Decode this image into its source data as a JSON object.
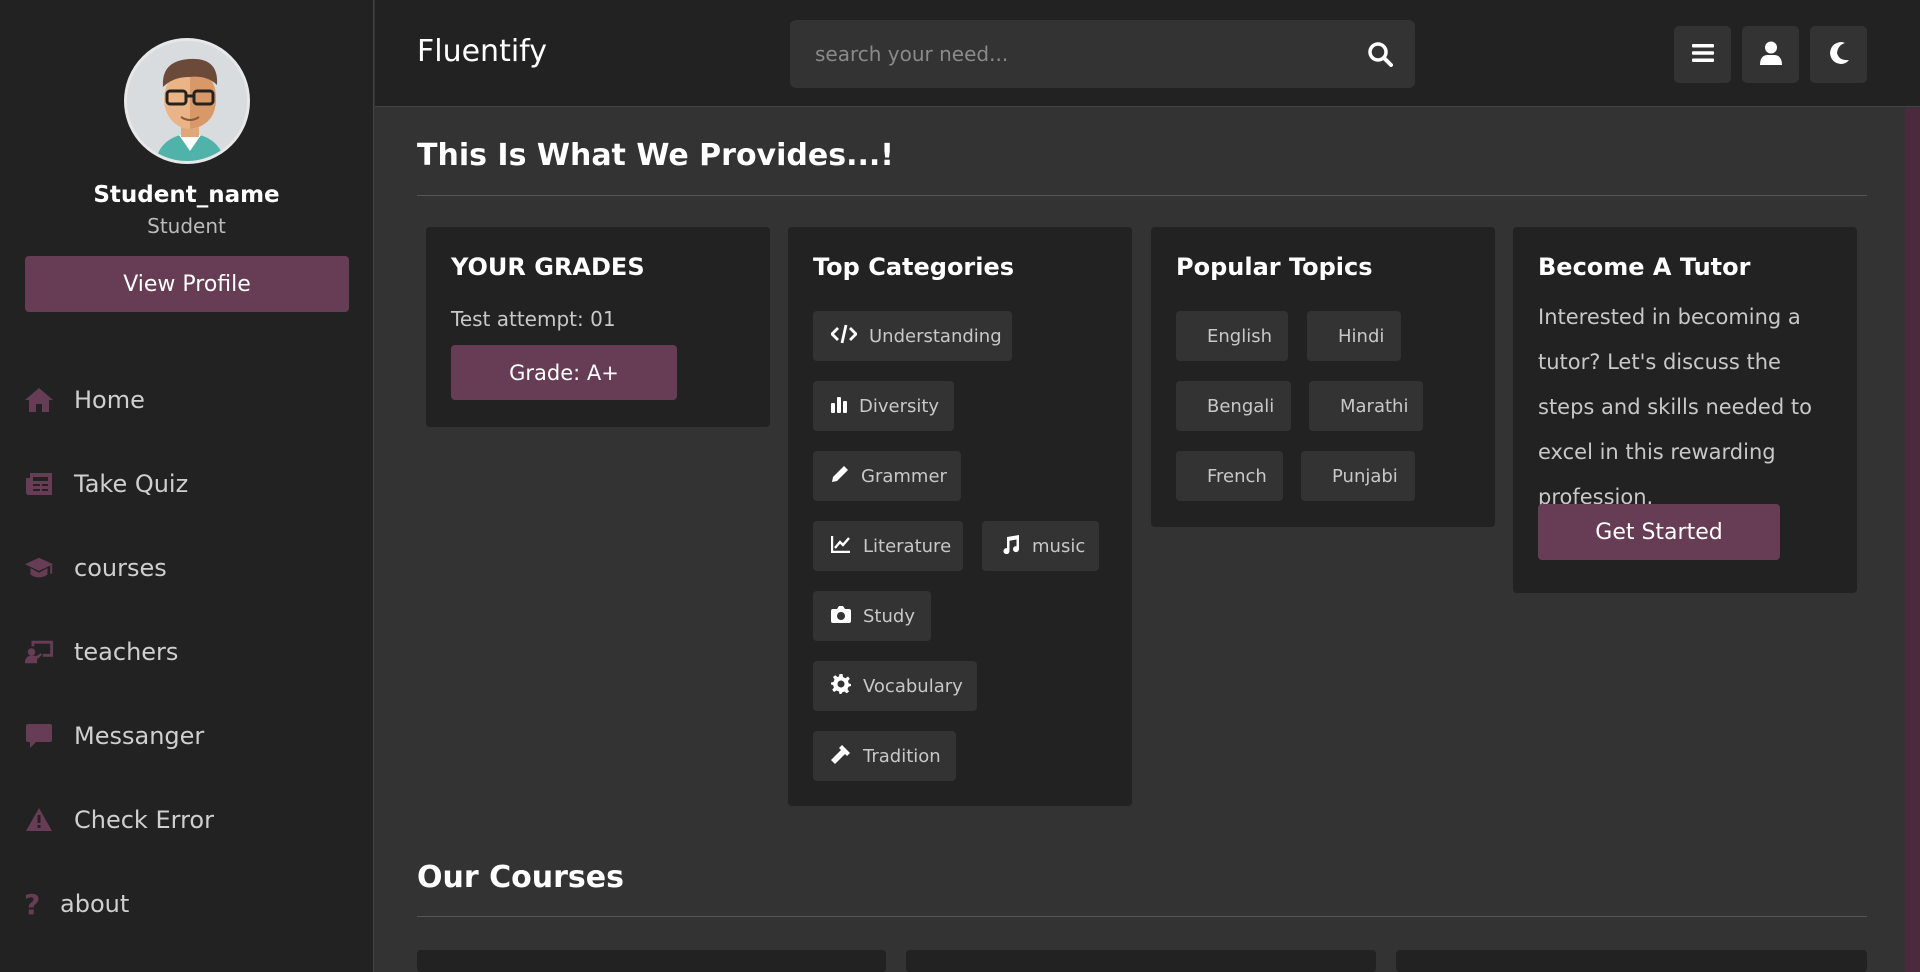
{
  "sidebar": {
    "student_name": "Student_name",
    "student_role": "Student",
    "view_profile_label": "View Profile",
    "items": [
      {
        "label": "Home",
        "icon": "home-icon"
      },
      {
        "label": "Take Quiz",
        "icon": "newspaper-icon"
      },
      {
        "label": "courses",
        "icon": "graduation-cap-icon"
      },
      {
        "label": "teachers",
        "icon": "chalkboard-teacher-icon"
      },
      {
        "label": "Messanger",
        "icon": "comment-icon"
      },
      {
        "label": "Check Error",
        "icon": "warning-icon"
      },
      {
        "label": "about",
        "icon": "question-icon"
      }
    ]
  },
  "header": {
    "brand": "Fluentify",
    "search_placeholder": "search your need...",
    "buttons": [
      "menu-icon",
      "user-icon",
      "moon-icon"
    ]
  },
  "main": {
    "section1_title": "This Is What We Provides...!",
    "grades": {
      "title": "YOUR GRADES",
      "attempt": "Test attempt: 01",
      "grade_label": "Grade: A+"
    },
    "categories": {
      "title": "Top Categories",
      "tags": [
        {
          "label": "Understanding",
          "icon": "code-icon"
        },
        {
          "label": "Diversity",
          "icon": "chart-bar-icon"
        },
        {
          "label": "Grammer",
          "icon": "pencil-icon"
        },
        {
          "label": "Literature",
          "icon": "chart-line-icon"
        },
        {
          "label": "music",
          "icon": "music-icon"
        },
        {
          "label": "Study",
          "icon": "camera-icon"
        },
        {
          "label": "Vocabulary",
          "icon": "cog-icon"
        },
        {
          "label": "Tradition",
          "icon": "hammer-icon"
        }
      ]
    },
    "topics": {
      "title": "Popular Topics",
      "tags": [
        "English",
        "Hindi",
        "Bengali",
        "Marathi",
        "French",
        "Punjabi"
      ]
    },
    "tutor": {
      "title": "Become A Tutor",
      "text": "Interested in becoming a tutor? Let's discuss the steps and skills needed to excel in this rewarding profession.",
      "button_label": "Get Started"
    },
    "section2_title": "Our Courses"
  },
  "colors": {
    "accent": "#673d55",
    "background": "#333333",
    "panel": "#222222"
  }
}
